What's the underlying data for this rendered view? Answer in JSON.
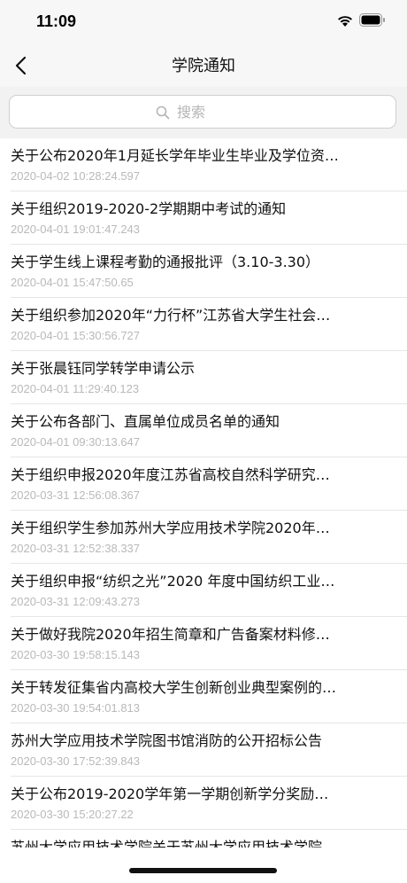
{
  "status": {
    "time": "11:09"
  },
  "nav": {
    "title": "学院通知"
  },
  "search": {
    "placeholder": "搜索"
  },
  "notices": [
    {
      "title": "关于公布2020年1月延长学年毕业生毕业及学位资…",
      "time": "2020-04-02 10:28:24.597"
    },
    {
      "title": "关于组织2019-2020-2学期期中考试的通知",
      "time": "2020-04-01 19:01:47.243"
    },
    {
      "title": "关于学生线上课程考勤的通报批评（3.10-3.30）",
      "time": "2020-04-01 15:47:50.65"
    },
    {
      "title": "关于组织参加2020年“力行杯”江苏省大学生社会…",
      "time": "2020-04-01 15:30:56.727"
    },
    {
      "title": "关于张晨钰同学转学申请公示",
      "time": "2020-04-01 11:29:40.123"
    },
    {
      "title": "关于公布各部门、直属单位成员名单的通知",
      "time": "2020-04-01 09:30:13.647"
    },
    {
      "title": "关于组织申报2020年度江苏省高校自然科学研究…",
      "time": "2020-03-31 12:56:08.367"
    },
    {
      "title": "关于组织学生参加苏州大学应用技术学院2020年…",
      "time": "2020-03-31 12:52:38.337"
    },
    {
      "title": "关于组织申报“纺织之光”2020 年度中国纺织工业…",
      "time": "2020-03-31 12:09:43.273"
    },
    {
      "title": "关于做好我院2020年招生简章和广告备案材料修…",
      "time": "2020-03-30 19:58:15.143"
    },
    {
      "title": "关于转发征集省内高校大学生创新创业典型案例的…",
      "time": "2020-03-30 19:54:01.813"
    },
    {
      "title": "苏州大学应用技术学院图书馆消防的公开招标公告",
      "time": "2020-03-30 17:52:39.843"
    },
    {
      "title": "关于公布2019-2020学年第一学期创新学分奖励…",
      "time": "2020-03-30 15:20:27.22"
    },
    {
      "title": "苏州大学应用技术学院关于苏州大学应用技术学院",
      "time": ""
    }
  ]
}
